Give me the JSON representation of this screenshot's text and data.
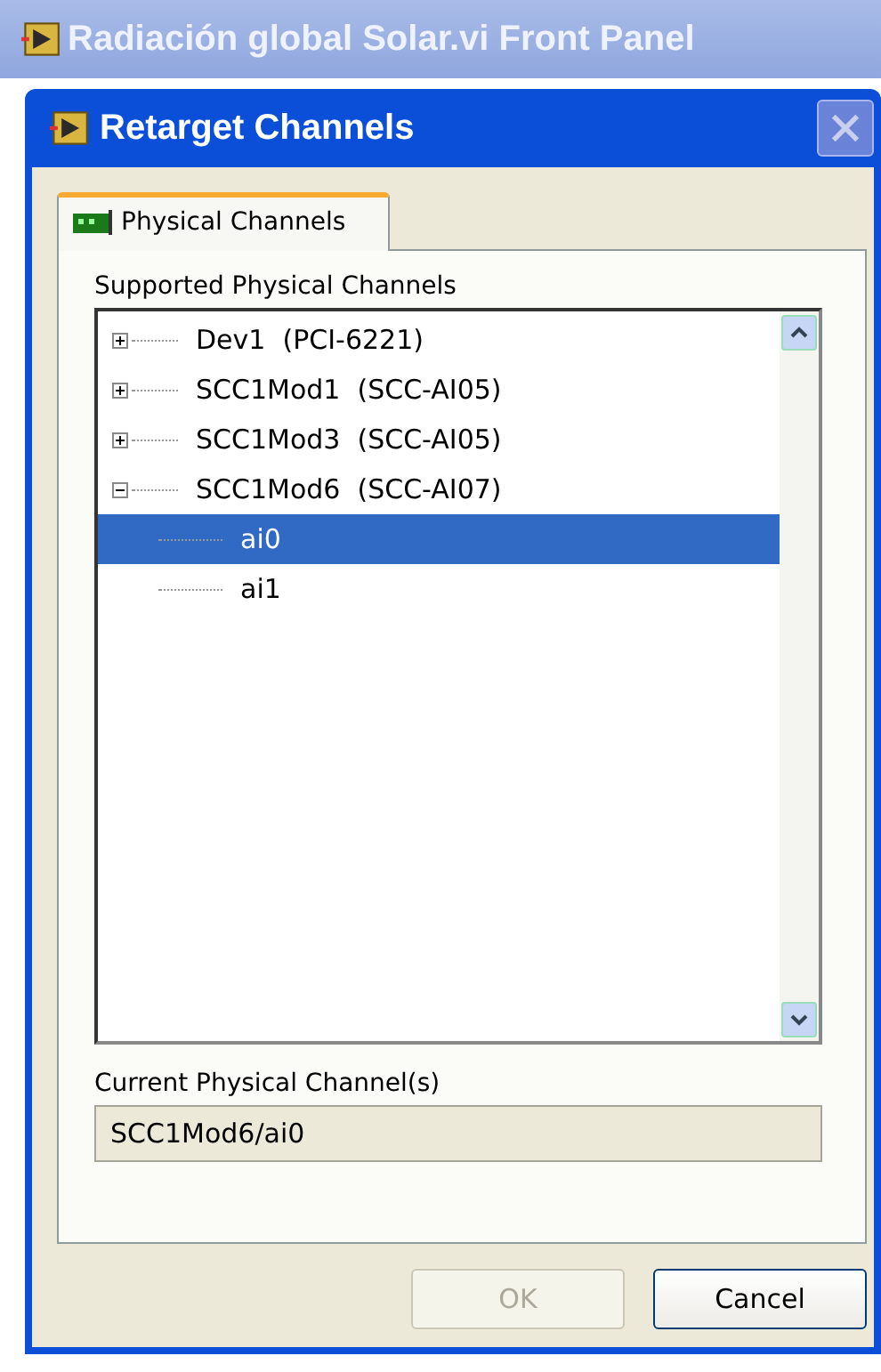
{
  "window": {
    "title": "Radiación global Solar.vi Front Panel"
  },
  "dialog": {
    "title": "Retarget Channels"
  },
  "tabs": [
    {
      "label": "Physical Channels",
      "selected": true
    }
  ],
  "tree": {
    "label": "Supported Physical Channels",
    "items": [
      {
        "label": "Dev1  (PCI-6221)",
        "expanded": false,
        "selected": false
      },
      {
        "label": "SCC1Mod1  (SCC-AI05)",
        "expanded": false,
        "selected": false
      },
      {
        "label": "SCC1Mod3  (SCC-AI05)",
        "expanded": false,
        "selected": false
      },
      {
        "label": "SCC1Mod6  (SCC-AI07)",
        "expanded": true,
        "selected": false,
        "children": [
          {
            "label": "ai0",
            "selected": true
          },
          {
            "label": "ai1",
            "selected": false
          }
        ]
      }
    ]
  },
  "current": {
    "label": "Current Physical Channel(s)",
    "value": "SCC1Mod6/ai0"
  },
  "buttons": [
    {
      "label": "OK",
      "disabled": true
    },
    {
      "label": "Cancel",
      "disabled": false
    }
  ]
}
